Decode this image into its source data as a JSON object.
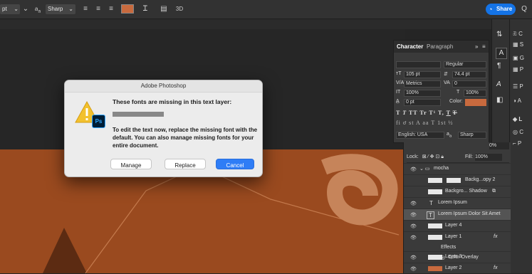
{
  "options_bar": {
    "size_unit": "pt",
    "aa_icon_label": "a",
    "aa_icon_sub": "a",
    "anti_alias": "Sharp",
    "warp_icon": "warp-text-icon",
    "panels_icon": "toggle-panels-icon",
    "three_d": "3D",
    "text_color": "#c86a3e",
    "share_label": "Share"
  },
  "character_panel": {
    "tab_character": "Character",
    "tab_paragraph": "Paragraph",
    "font_style": "Regular",
    "font_size": "105 pt",
    "leading": "74.4 pt",
    "kerning": "Metrics",
    "tracking": "0",
    "vertical_scale": "100%",
    "horizontal_scale": "100%",
    "baseline_shift": "0 pt",
    "color_label": "Color:",
    "color_value": "#c86a3e",
    "language": "English: USA",
    "anti_alias_mark": "a",
    "anti_alias_sub": "a",
    "anti_alias": "Sharp",
    "style_buttons": [
      "T",
      "T",
      "TT",
      "Tr",
      "T¹",
      "T,",
      "T",
      "T"
    ],
    "opentype_buttons": [
      "fi",
      "ơ",
      "st",
      "A",
      "aa",
      "T",
      "1st",
      "½"
    ]
  },
  "right_panel": {
    "items": [
      "C",
      "S",
      "G",
      "P",
      "P",
      "A",
      "L",
      "C",
      "P"
    ]
  },
  "layers_panel": {
    "lock_label": "Lock:",
    "fill_label": "Fill:",
    "fill_value": "100%",
    "opacity_value": "0%",
    "layers": [
      {
        "name": "mocha",
        "kind": "group"
      },
      {
        "name": "Backg...opy 2",
        "kind": "image"
      },
      {
        "name": "Backgro... Shadow",
        "kind": "image"
      },
      {
        "name": "Lorem Ipsum",
        "kind": "text"
      },
      {
        "name": "Lorem Ipsum Dolor Sit Amet",
        "kind": "text-missing"
      },
      {
        "name": "Layer 4",
        "kind": "image"
      },
      {
        "name": "Layer 1",
        "kind": "image",
        "fx": "fx"
      },
      {
        "name": "Effects",
        "kind": "effects"
      },
      {
        "name": "Color Overlay",
        "kind": "effect"
      },
      {
        "name": "Layer 3",
        "kind": "image"
      },
      {
        "name": "Layer 2",
        "kind": "image",
        "fx": "fx"
      }
    ]
  },
  "dialog": {
    "title": "Adobe Photoshop",
    "heading": "These fonts are missing in this text layer:",
    "body": "To edit the text now, replace the missing font with the default. You can also manage missing fonts for your entire document.",
    "app_badge": "Ps",
    "buttons": {
      "manage": "Manage",
      "replace": "Replace",
      "cancel": "Cancel"
    }
  }
}
